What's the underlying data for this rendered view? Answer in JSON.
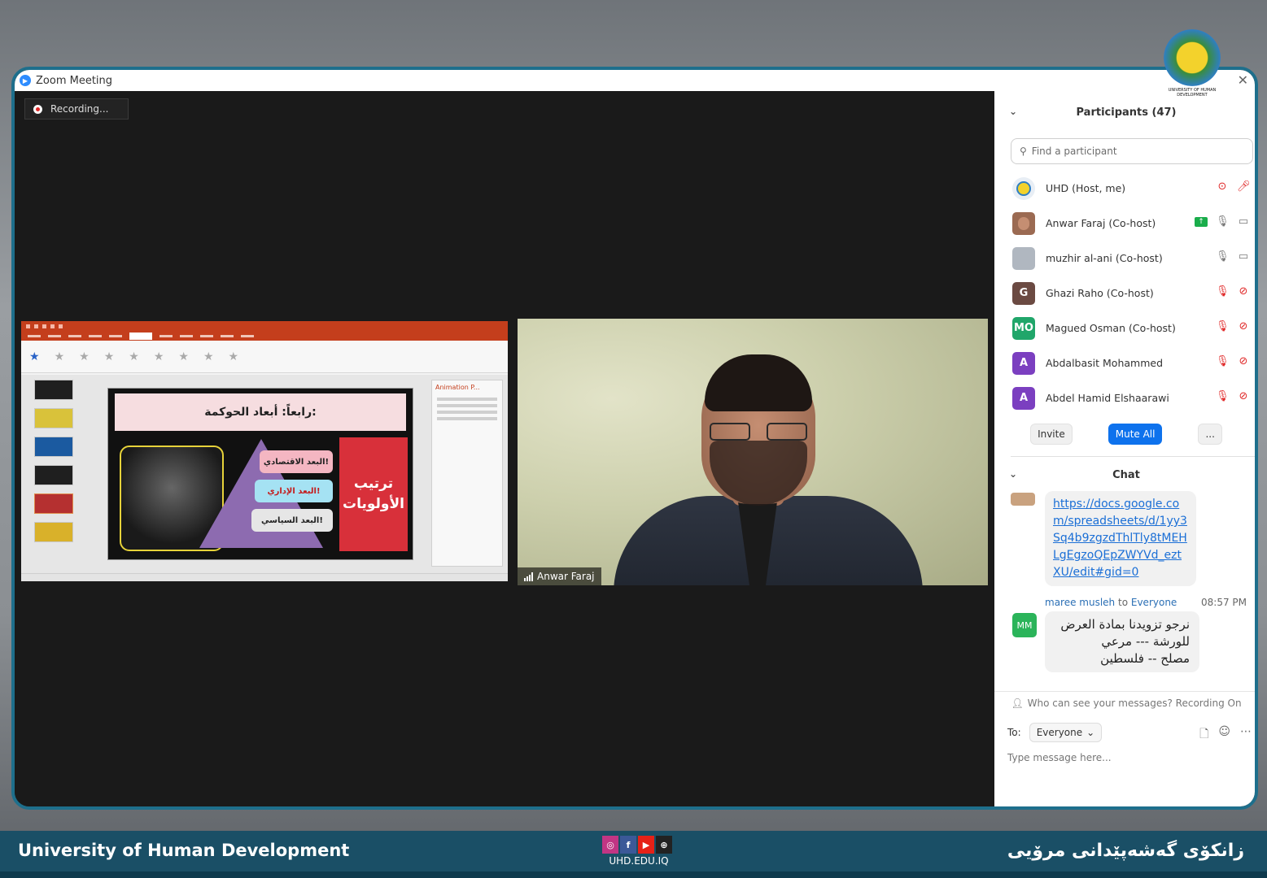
{
  "window": {
    "title": "Zoom Meeting",
    "close_glyph": "✕"
  },
  "recording": {
    "label": "Recording..."
  },
  "shared_slide": {
    "title": "رابعاً: أبعاد الحوكمة:",
    "items": [
      "البعد الاقتصادي!",
      "البعد الإداري!",
      "البعد السياسي!"
    ],
    "side_box": "ترتيب الأولويات",
    "pane_title": "Animation P..."
  },
  "speaker": {
    "name": "Anwar Faraj"
  },
  "participants": {
    "header": "Participants (47)",
    "search_placeholder": "Find a participant",
    "list": [
      {
        "name": "UHD (Host, me)",
        "initials": "",
        "color": "#e9e9e9"
      },
      {
        "name": "Anwar Faraj (Co-host)",
        "initials": "",
        "color": "#9b6a52"
      },
      {
        "name": "muzhir al-ani (Co-host)",
        "initials": "",
        "color": "#b0b7c0"
      },
      {
        "name": "Ghazi Raho (Co-host)",
        "initials": "G",
        "color": "#6b4a42"
      },
      {
        "name": "Magued Osman (Co-host)",
        "initials": "MO",
        "color": "#20a66a"
      },
      {
        "name": "Abdalbasit Mohammed",
        "initials": "A",
        "color": "#7b3fc0"
      },
      {
        "name": "Abdel Hamid Elshaarawi",
        "initials": "A",
        "color": "#7b3fc0"
      }
    ],
    "invite_label": "Invite",
    "mute_all_label": "Mute All",
    "more_label": "..."
  },
  "chat": {
    "header": "Chat",
    "link_message": "https://docs.google.com/spreadsheets/d/1yy3Sq4b9zgzdThlTly8tMEHLgEgzoQEpZWYVd_eztXU/edit#gid=0",
    "sender": "maree musleh",
    "to_word": "to",
    "recipient": "Everyone",
    "time": "08:57 PM",
    "sender_initials": "MM",
    "message_lines": [
      "نرجو تزويدنا بمادة العرض",
      "للورشة --- مرعي",
      "مصلح -- فلسطين"
    ],
    "privacy_note": "Who can see your messages? Recording On",
    "to_label": "To:",
    "to_value": "Everyone",
    "input_placeholder": "Type message here..."
  },
  "footer": {
    "left_text": "University of Human Development",
    "right_text": "زانكۆی گەشەپێدانی مرۆیی",
    "url": "UHD.EDU.IQ"
  },
  "logo": {
    "caption": "UNIVERSITY OF HUMAN DEVELOPMENT"
  },
  "colors": {
    "frame": "#1e6f8c",
    "footer": "#1a4f66",
    "zoom_blue": "#0e72ed",
    "muted_red": "#e02828"
  }
}
